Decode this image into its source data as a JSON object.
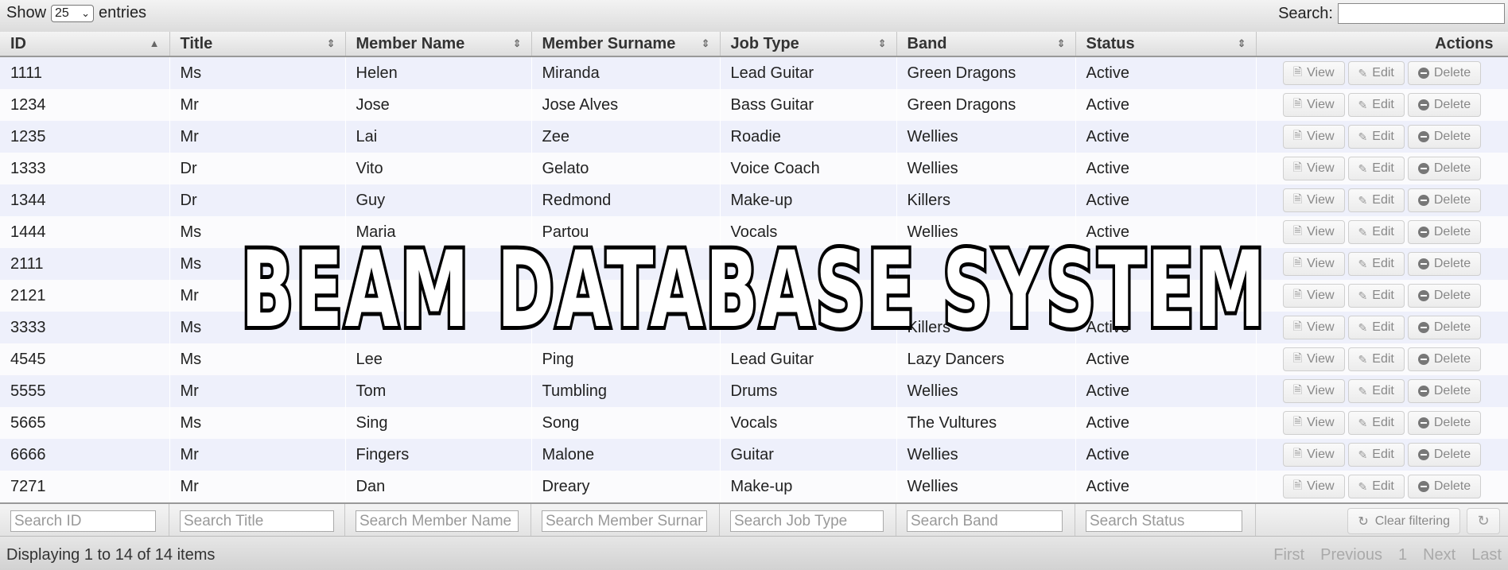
{
  "top": {
    "show_label": "Show",
    "page_size": "25",
    "entries_label": "entries",
    "search_label": "Search:"
  },
  "columns": [
    "ID",
    "Title",
    "Member Name",
    "Member Surname",
    "Job Type",
    "Band",
    "Status",
    "Actions"
  ],
  "rows": [
    {
      "id": "1111",
      "title": "Ms",
      "name": "Helen",
      "surname": "Miranda",
      "job": "Lead Guitar",
      "band": "Green Dragons",
      "status": "Active"
    },
    {
      "id": "1234",
      "title": "Mr",
      "name": "Jose",
      "surname": "Jose Alves",
      "job": "Bass Guitar",
      "band": "Green Dragons",
      "status": "Active"
    },
    {
      "id": "1235",
      "title": "Mr",
      "name": "Lai",
      "surname": "Zee",
      "job": "Roadie",
      "band": "Wellies",
      "status": "Active"
    },
    {
      "id": "1333",
      "title": "Dr",
      "name": "Vito",
      "surname": "Gelato",
      "job": "Voice Coach",
      "band": "Wellies",
      "status": "Active"
    },
    {
      "id": "1344",
      "title": "Dr",
      "name": "Guy",
      "surname": "Redmond",
      "job": "Make-up",
      "band": "Killers",
      "status": "Active"
    },
    {
      "id": "1444",
      "title": "Ms",
      "name": "Maria",
      "surname": "Partou",
      "job": "Vocals",
      "band": "Wellies",
      "status": "Active"
    },
    {
      "id": "2111",
      "title": "Ms",
      "name": "",
      "surname": "",
      "job": "",
      "band": "",
      "status": ""
    },
    {
      "id": "2121",
      "title": "Mr",
      "name": "",
      "surname": "",
      "job": "",
      "band": "",
      "status": ""
    },
    {
      "id": "3333",
      "title": "Ms",
      "name": "",
      "surname": "",
      "job": "",
      "band": "Killers",
      "status": "Active"
    },
    {
      "id": "4545",
      "title": "Ms",
      "name": "Lee",
      "surname": "Ping",
      "job": "Lead Guitar",
      "band": "Lazy Dancers",
      "status": "Active"
    },
    {
      "id": "5555",
      "title": "Mr",
      "name": "Tom",
      "surname": "Tumbling",
      "job": "Drums",
      "band": "Wellies",
      "status": "Active"
    },
    {
      "id": "5665",
      "title": "Ms",
      "name": "Sing",
      "surname": "Song",
      "job": "Vocals",
      "band": "The Vultures",
      "status": "Active"
    },
    {
      "id": "6666",
      "title": "Mr",
      "name": "Fingers",
      "surname": "Malone",
      "job": "Guitar",
      "band": "Wellies",
      "status": "Active"
    },
    {
      "id": "7271",
      "title": "Mr",
      "name": "Dan",
      "surname": "Dreary",
      "job": "Make-up",
      "band": "Wellies",
      "status": "Active"
    }
  ],
  "row_actions": {
    "view": "View",
    "edit": "Edit",
    "delete": "Delete"
  },
  "filters": [
    "Search ID",
    "Search Title",
    "Search Member Name",
    "Search Member Surname",
    "Search Job Type",
    "Search Band",
    "Search Status"
  ],
  "clear_filtering": "Clear filtering",
  "footer": {
    "info": "Displaying 1 to 14 of 14 items",
    "pager": [
      "First",
      "Previous",
      "1",
      "Next",
      "Last"
    ]
  },
  "overlay_title": "BEAM  DATABASE SYSTEM"
}
